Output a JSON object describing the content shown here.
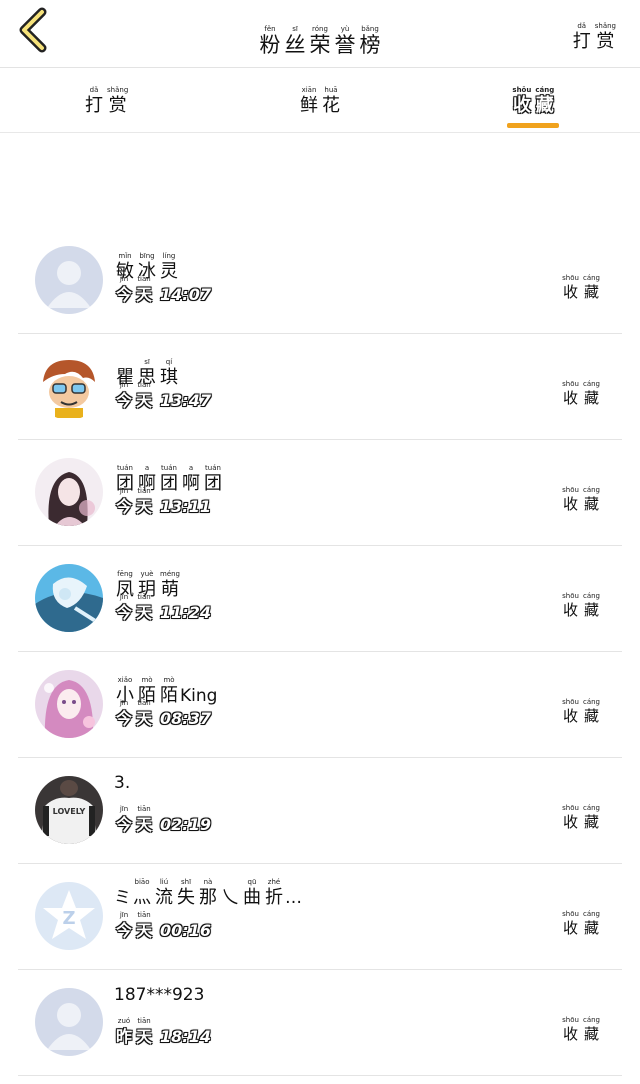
{
  "header": {
    "title": [
      {
        "py": "fěn",
        "hz": "粉"
      },
      {
        "py": "sī",
        "hz": "丝"
      },
      {
        "py": "róng",
        "hz": "荣"
      },
      {
        "py": "yù",
        "hz": "誉"
      },
      {
        "py": "bǎng",
        "hz": "榜"
      }
    ],
    "right_action": [
      {
        "py": "dǎ",
        "hz": "打"
      },
      {
        "py": "shǎng",
        "hz": "赏"
      }
    ]
  },
  "tabs": [
    {
      "chars": [
        {
          "py": "dǎ",
          "hz": "打"
        },
        {
          "py": "shǎng",
          "hz": "赏"
        }
      ],
      "active": false
    },
    {
      "chars": [
        {
          "py": "xiān",
          "hz": "鲜"
        },
        {
          "py": "huā",
          "hz": "花"
        }
      ],
      "active": false
    },
    {
      "chars": [
        {
          "py": "shōu",
          "hz": "收"
        },
        {
          "py": "cáng",
          "hz": "藏"
        }
      ],
      "active": true
    }
  ],
  "accent_color": "#f0a21d",
  "row_action": [
    {
      "py": "shōu",
      "hz": "收"
    },
    {
      "py": "cáng",
      "hz": "藏"
    }
  ],
  "users": [
    {
      "name": [
        {
          "py": "mǐn",
          "hz": "敏"
        },
        {
          "py": "bīng",
          "hz": "冰"
        },
        {
          "py": "líng",
          "hz": "灵"
        }
      ],
      "day": [
        {
          "py": "jīn",
          "hz": "今"
        },
        {
          "py": "tiān",
          "hz": "天"
        }
      ],
      "time": "14:07",
      "avatar": "default-avatar"
    },
    {
      "name": [
        {
          "py": "",
          "hz": "瞿"
        },
        {
          "py": "sī",
          "hz": "思"
        },
        {
          "py": "qí",
          "hz": "琪"
        }
      ],
      "day": [
        {
          "py": "jīn",
          "hz": "今"
        },
        {
          "py": "tiān",
          "hz": "天"
        }
      ],
      "time": "13:47",
      "avatar": "cartoon-avatar"
    },
    {
      "name": [
        {
          "py": "tuán",
          "hz": "团"
        },
        {
          "py": "a",
          "hz": "啊"
        },
        {
          "py": "tuán",
          "hz": "团"
        },
        {
          "py": "a",
          "hz": "啊"
        },
        {
          "py": "tuán",
          "hz": "团"
        }
      ],
      "day": [
        {
          "py": "jīn",
          "hz": "今"
        },
        {
          "py": "tiān",
          "hz": "天"
        }
      ],
      "time": "13:11",
      "avatar": "anime-girl-avatar"
    },
    {
      "name": [
        {
          "py": "fēng",
          "hz": "凤"
        },
        {
          "py": "yuè",
          "hz": "玥"
        },
        {
          "py": "méng",
          "hz": "萌"
        }
      ],
      "day": [
        {
          "py": "jīn",
          "hz": "今"
        },
        {
          "py": "tiān",
          "hz": "天"
        }
      ],
      "time": "11:24",
      "avatar": "blue-anime-avatar"
    },
    {
      "name": [
        {
          "py": "xiǎo",
          "hz": "小"
        },
        {
          "py": "mò",
          "hz": "陌"
        },
        {
          "py": "mò",
          "hz": "陌"
        }
      ],
      "name_suffix": "King",
      "day": [
        {
          "py": "jīn",
          "hz": "今"
        },
        {
          "py": "tiān",
          "hz": "天"
        }
      ],
      "time": "08:37",
      "avatar": "pink-anime-avatar"
    },
    {
      "name_text": "3.",
      "day": [
        {
          "py": "jīn",
          "hz": "今"
        },
        {
          "py": "tiān",
          "hz": "天"
        }
      ],
      "time": "02:19",
      "avatar": "shirt-photo-avatar"
    },
    {
      "name_prefix": "ミ",
      "name": [
        {
          "py": "biāo",
          "hz": "灬"
        },
        {
          "py": "liú",
          "hz": "流"
        },
        {
          "py": "shī",
          "hz": "失"
        },
        {
          "py": "nà",
          "hz": "那"
        },
        {
          "py": "",
          "hz": "乀"
        },
        {
          "py": "qū",
          "hz": "曲"
        },
        {
          "py": "zhé",
          "hz": "折"
        }
      ],
      "name_suffix": "…",
      "day": [
        {
          "py": "jīn",
          "hz": "今"
        },
        {
          "py": "tiān",
          "hz": "天"
        }
      ],
      "time": "00:16",
      "avatar": "qq-logo-avatar"
    },
    {
      "name_text": "187***923",
      "day": [
        {
          "py": "zuó",
          "hz": "昨"
        },
        {
          "py": "tiān",
          "hz": "天"
        }
      ],
      "time": "18:14",
      "avatar": "default-avatar"
    }
  ]
}
